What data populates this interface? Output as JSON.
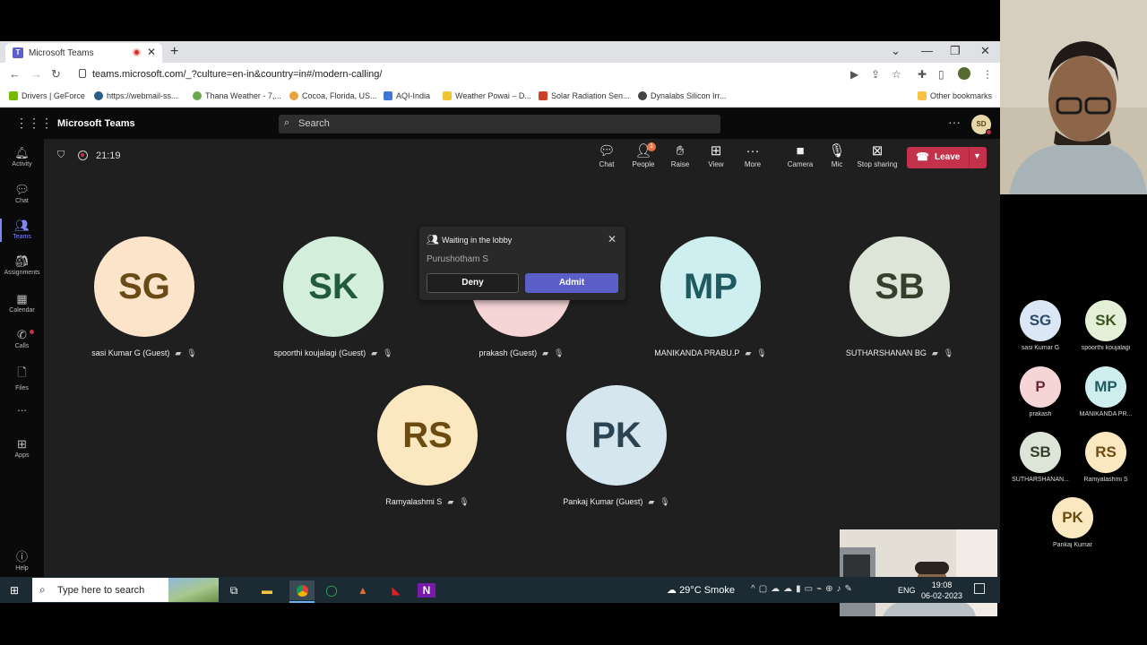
{
  "browser": {
    "tab_title": "Microsoft Teams",
    "url": "teams.microsoft.com/_?culture=en-in&country=in#/modern-calling/",
    "bookmarks": [
      "Drivers | GeForce",
      "https://webmail-ss...",
      "Thana Weather - 7,...",
      "Cocoa, Florida, US...",
      "AQI-India",
      "Weather Powai – D...",
      "Solar Radiation Sen...",
      "Dynalabs Silicon Irr..."
    ],
    "other_bookmarks": "Other bookmarks"
  },
  "teams": {
    "app_title": "Microsoft Teams",
    "search_placeholder": "Search",
    "user_initials": "SD",
    "rail": [
      {
        "label": "Activity",
        "icon": "bell-icon"
      },
      {
        "label": "Chat",
        "icon": "chat-icon"
      },
      {
        "label": "Teams",
        "icon": "teams-icon"
      },
      {
        "label": "Assignments",
        "icon": "assignments-icon"
      },
      {
        "label": "Calendar",
        "icon": "calendar-icon"
      },
      {
        "label": "Calls",
        "icon": "phone-icon"
      },
      {
        "label": "Files",
        "icon": "file-icon"
      },
      {
        "label": "...",
        "icon": "more-icon"
      },
      {
        "label": "Apps",
        "icon": "apps-icon"
      },
      {
        "label": "Help",
        "icon": "help-icon"
      }
    ]
  },
  "meeting": {
    "timer": "21:19",
    "controls": {
      "chat": "Chat",
      "people": "People",
      "people_badge": "1",
      "raise": "Raise",
      "view": "View",
      "more": "More",
      "camera": "Camera",
      "mic": "Mic",
      "stop_sharing": "Stop sharing",
      "leave": "Leave"
    },
    "participants": [
      {
        "initials": "SG",
        "name": "sasi Kumar G (Guest)",
        "bg": "#fbe4c9",
        "fg": "#6b4a1a"
      },
      {
        "initials": "SK",
        "name": "spoorthi koujalagi (Guest)",
        "bg": "#d3efdc",
        "fg": "#235a39"
      },
      {
        "initials": "P",
        "name": "prakash (Guest)",
        "bg": "#f6d5d7",
        "fg": "#6b2a30"
      },
      {
        "initials": "MP",
        "name": "MANIKANDA PRABU.P",
        "bg": "#cfeef0",
        "fg": "#1f5a60"
      },
      {
        "initials": "SB",
        "name": "SUTHARSHANAN BG",
        "bg": "#dde5d8",
        "fg": "#33402c"
      },
      {
        "initials": "RS",
        "name": "Ramyalashmi S",
        "bg": "#fbe8c0",
        "fg": "#6b4b12"
      },
      {
        "initials": "PK",
        "name": "Pankaj Kumar (Guest)",
        "bg": "#d6e6ef",
        "fg": "#2a4454"
      }
    ],
    "lobby": {
      "title": "Waiting in the lobby",
      "person": "Purushotham S",
      "deny": "Deny",
      "admit": "Admit"
    }
  },
  "side_panel": [
    {
      "initials": "SG",
      "name": "sasi Kumar G",
      "bg": "#dbe7f4",
      "fg": "#2d4a6b"
    },
    {
      "initials": "SK",
      "name": "spoorthi koujalagi",
      "bg": "#e3efd6",
      "fg": "#3a5522"
    },
    {
      "initials": "P",
      "name": "prakash",
      "bg": "#f6d5d7",
      "fg": "#6b2a30"
    },
    {
      "initials": "MP",
      "name": "MANIKANDA PR...",
      "bg": "#cfeef0",
      "fg": "#1f5a60"
    },
    {
      "initials": "SB",
      "name": "SUTHARSHANAN...",
      "bg": "#dde5d8",
      "fg": "#33402c"
    },
    {
      "initials": "RS",
      "name": "Ramyalashmi S",
      "bg": "#fbe8c0",
      "fg": "#6b4b12"
    },
    {
      "initials": "PK",
      "name": "Pankaj Kumar",
      "bg": "#fbe8c0",
      "fg": "#6b4b12"
    }
  ],
  "taskbar": {
    "search_placeholder": "Type here to search",
    "weather": "29°C  Smoke",
    "lang": "ENG",
    "time": "19:08",
    "date": "06-02-2023"
  }
}
